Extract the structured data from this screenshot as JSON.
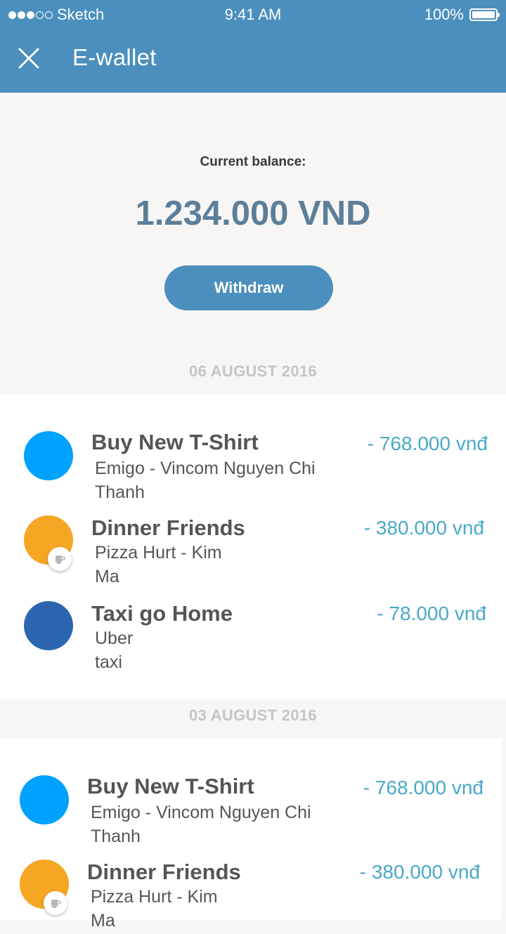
{
  "status_bar": {
    "carrier": "Sketch",
    "time": "9:41 AM",
    "battery": "100%",
    "signal_dots_filled": 3,
    "signal_dots_total": 5
  },
  "nav": {
    "title": "E-wallet",
    "close_icon": "close-icon"
  },
  "balance": {
    "label": "Current balance:",
    "amount": "1.234.000 VND"
  },
  "withdraw_button": "Withdraw",
  "groups": [
    {
      "date": "06 AUGUST 2016",
      "transactions": [
        {
          "title": "Buy New T-Shirt",
          "subtitle_line1": "Emigo - Vincom Nguyen Chi",
          "subtitle_line2": "Thanh",
          "amount": "- 768.000 vnđ",
          "color": "#00a2ff",
          "badge": ""
        },
        {
          "title": "Dinner Friends",
          "subtitle_line1": "Pizza Hurt - Kim",
          "subtitle_line2": "Ma",
          "amount": "- 380.000 vnđ",
          "color": "#f5a623",
          "badge": "cup-icon"
        },
        {
          "title": "Taxi go Home",
          "subtitle_line1": "Uber",
          "subtitle_line2": "taxi",
          "amount": "- 78.000 vnđ",
          "color": "#2d66b0",
          "badge": ""
        }
      ]
    },
    {
      "date": "03 AUGUST 2016",
      "transactions": [
        {
          "title": "Buy New T-Shirt",
          "subtitle_line1": "Emigo - Vincom Nguyen Chi",
          "subtitle_line2": "Thanh",
          "amount": "- 768.000 vnđ",
          "color": "#00a2ff",
          "badge": ""
        },
        {
          "title": "Dinner Friends",
          "subtitle_line1": "Pizza Hurt - Kim",
          "subtitle_line2": "Ma",
          "amount": "- 380.000 vnđ",
          "color": "#f5a623",
          "badge": "cup-icon"
        }
      ]
    }
  ],
  "colors": {
    "primary": "#4a8fbd",
    "amount": "#48a9c8",
    "balance": "#5c7f99"
  }
}
